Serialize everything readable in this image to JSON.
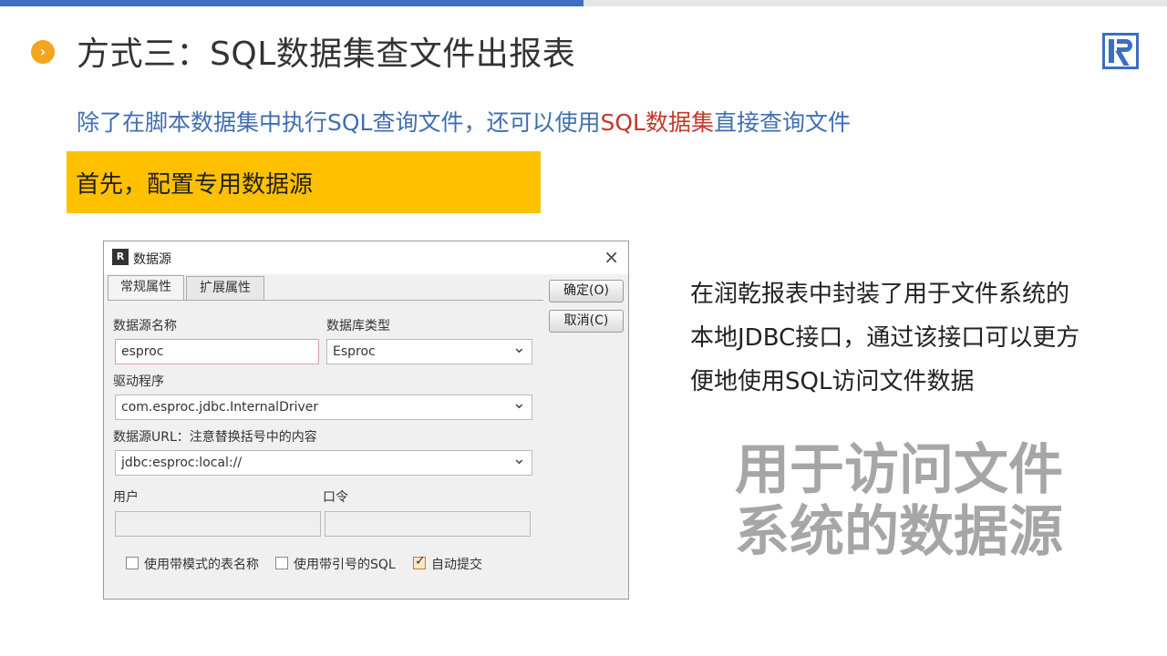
{
  "slide": {
    "title": "方式三：SQL数据集查文件出报表",
    "bullet_icon": "chevron-right-icon",
    "logo_icon": "brand-logo-icon",
    "subtitle_prefix": "除了在脚本数据集中执行SQL查询文件，还可以使用",
    "subtitle_highlight": "SQL数据集",
    "subtitle_suffix": "直接查询文件",
    "callout": "首先，配置专用数据源",
    "description_lines": [
      "在润乾报表中封装了用于文件系统的",
      "本地JDBC接口，通过该接口可以更方",
      "便地使用SQL访问文件数据"
    ],
    "big_text_lines": [
      "用于访问文件",
      "系统的数据源"
    ],
    "colors": {
      "accent_blue": "#3f6fc5",
      "callout_yellow": "#ffc000",
      "highlight_red": "#c0392b",
      "big_text_gray": "#a6a6a6"
    }
  },
  "dialog": {
    "title": "数据源",
    "close": "×",
    "tabs": [
      "常规属性",
      "扩展属性"
    ],
    "ok_button": "确定(O)",
    "cancel_button": "取消(C)",
    "ds_name_label": "数据源名称",
    "ds_name_value": "esproc",
    "db_type_label": "数据库类型",
    "db_type_value": "Esproc",
    "driver_label": "驱动程序",
    "driver_value": "com.esproc.jdbc.InternalDriver",
    "url_label": "数据源URL：注意替换括号中的内容",
    "url_value": "jdbc:esproc:local://",
    "user_label": "用户",
    "password_label": "口令",
    "checkboxes": [
      {
        "label": "使用带模式的表名称",
        "checked": false
      },
      {
        "label": "使用带引号的SQL",
        "checked": false
      },
      {
        "label": "自动提交",
        "checked": true
      }
    ]
  }
}
